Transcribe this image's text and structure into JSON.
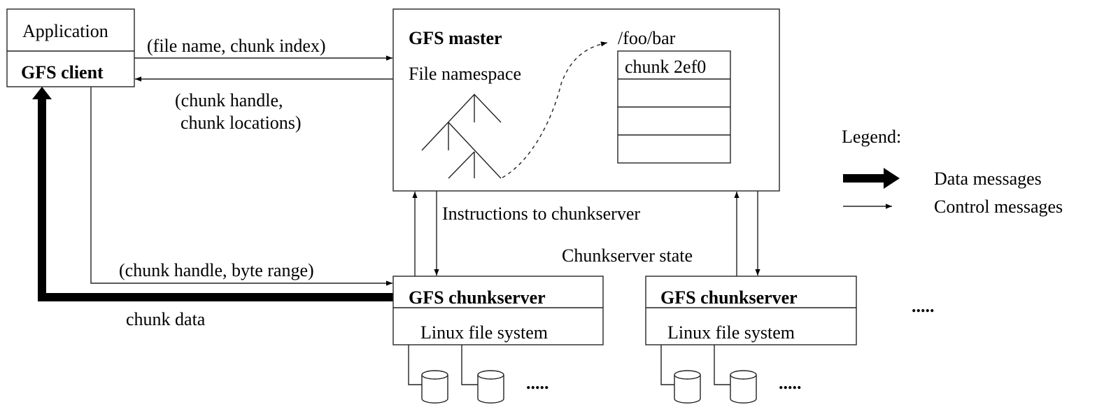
{
  "client": {
    "app_label": "Application",
    "client_label": "GFS client"
  },
  "master": {
    "title": "GFS master",
    "namespace_label": "File namespace",
    "file_path": "/foo/bar",
    "chunk_label": "chunk 2ef0"
  },
  "messages": {
    "request": "(file name, chunk index)",
    "reply_line1": "(chunk handle,",
    "reply_line2": "chunk locations)",
    "instructions": "Instructions to chunkserver",
    "state": "Chunkserver state",
    "read_request": "(chunk handle, byte range)",
    "chunk_data": "chunk data"
  },
  "chunkservers": [
    {
      "title": "GFS chunkserver",
      "fs_label": "Linux file system",
      "more_disks": "....."
    },
    {
      "title": "GFS chunkserver",
      "fs_label": "Linux file system",
      "more_disks": "....."
    }
  ],
  "more_servers": ".....",
  "legend": {
    "title": "Legend:",
    "data": "Data messages",
    "control": "Control messages"
  }
}
